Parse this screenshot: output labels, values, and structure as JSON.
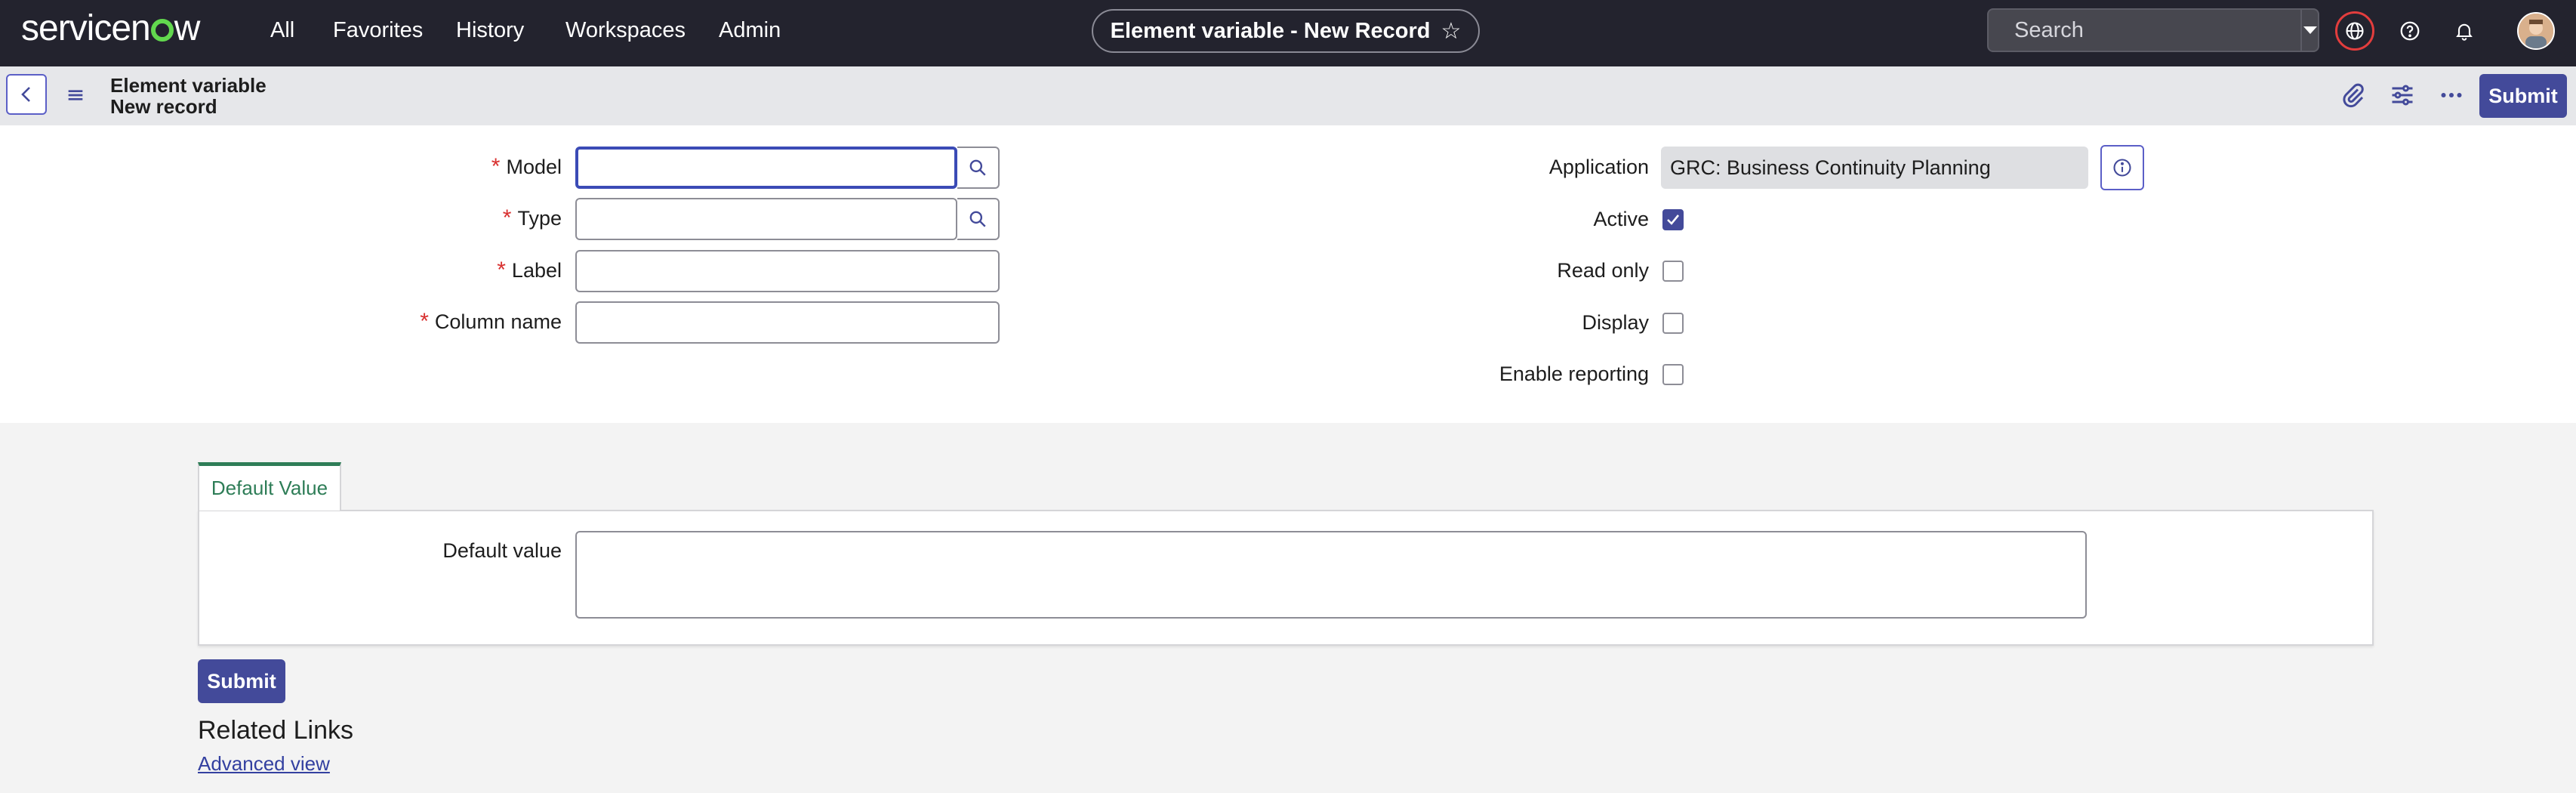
{
  "nav": {
    "logo": "servicenow",
    "links": [
      "All",
      "Favorites",
      "History",
      "Workspaces",
      "Admin"
    ],
    "record_title": "Element variable - New Record",
    "search_placeholder": "Search"
  },
  "header": {
    "title_line1": "Element variable",
    "title_line2": "New record",
    "submit_label": "Submit"
  },
  "form": {
    "model_label": "Model",
    "type_label": "Type",
    "label_label": "Label",
    "column_name_label": "Column name",
    "application_label": "Application",
    "application_value": "GRC: Business Continuity Planning",
    "active_label": "Active",
    "active_checked": true,
    "read_only_label": "Read only",
    "display_label": "Display",
    "enable_reporting_label": "Enable reporting"
  },
  "tabs": {
    "default_value_tab": "Default Value",
    "default_value_label": "Default value"
  },
  "footer": {
    "submit_label": "Submit",
    "related_links_title": "Related Links",
    "advanced_view_link": "Advanced view"
  },
  "colors": {
    "nav_bg": "#23232e",
    "accent": "#434a9a",
    "required": "#d8302f",
    "tab_green": "#2e7d57"
  }
}
